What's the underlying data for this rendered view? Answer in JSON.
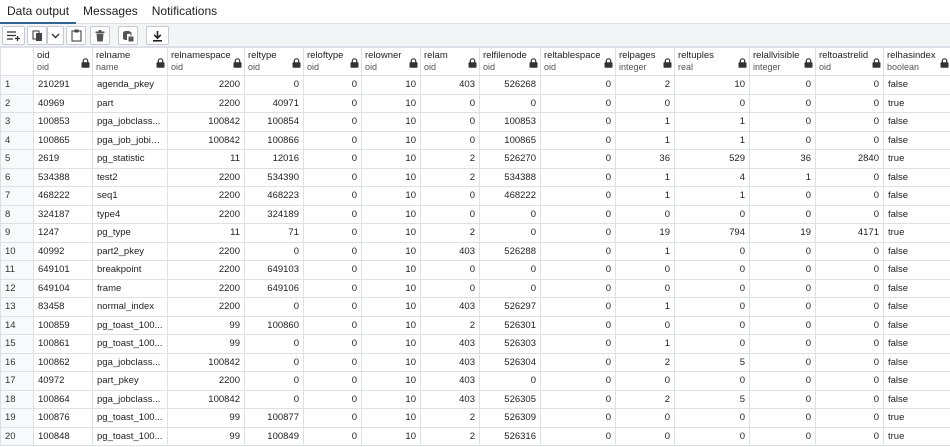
{
  "tabs": [
    {
      "label": "Data output",
      "active": true
    },
    {
      "label": "Messages",
      "active": false
    },
    {
      "label": "Notifications",
      "active": false
    }
  ],
  "toolbar": {
    "buttons": [
      {
        "icon": "add-row-icon"
      },
      {
        "icon": "copy-icon"
      },
      {
        "icon": "chevron-down-icon"
      },
      {
        "icon": "paste-icon"
      },
      {
        "icon": "delete-icon"
      },
      {
        "icon": "save-data-icon"
      },
      {
        "icon": "download-icon"
      }
    ]
  },
  "grid": {
    "columns": [
      {
        "name": "oid",
        "type": "oid",
        "locked": true,
        "align": "left"
      },
      {
        "name": "relname",
        "type": "name",
        "locked": true,
        "align": "left"
      },
      {
        "name": "relnamespace",
        "type": "oid",
        "locked": true,
        "align": "right"
      },
      {
        "name": "reltype",
        "type": "oid",
        "locked": true,
        "align": "right"
      },
      {
        "name": "reloftype",
        "type": "oid",
        "locked": true,
        "align": "right"
      },
      {
        "name": "relowner",
        "type": "oid",
        "locked": true,
        "align": "right"
      },
      {
        "name": "relam",
        "type": "oid",
        "locked": true,
        "align": "right"
      },
      {
        "name": "relfilenode",
        "type": "oid",
        "locked": true,
        "align": "right"
      },
      {
        "name": "reltablespace",
        "type": "oid",
        "locked": true,
        "align": "right"
      },
      {
        "name": "relpages",
        "type": "integer",
        "locked": true,
        "align": "right"
      },
      {
        "name": "reltuples",
        "type": "real",
        "locked": true,
        "align": "right"
      },
      {
        "name": "relallvisible",
        "type": "integer",
        "locked": true,
        "align": "right"
      },
      {
        "name": "reltoastrelid",
        "type": "oid",
        "locked": true,
        "align": "right"
      },
      {
        "name": "relhasindex",
        "type": "boolean",
        "locked": true,
        "align": "left"
      }
    ],
    "rows": [
      [
        "1",
        "210291",
        "agenda_pkey",
        "2200",
        "0",
        "0",
        "10",
        "403",
        "526268",
        "0",
        "2",
        "10",
        "0",
        "0",
        "false"
      ],
      [
        "2",
        "40969",
        "part",
        "2200",
        "40971",
        "0",
        "10",
        "0",
        "0",
        "0",
        "0",
        "0",
        "0",
        "0",
        "true"
      ],
      [
        "3",
        "100853",
        "pga_jobclass...",
        "100842",
        "100854",
        "0",
        "10",
        "0",
        "100853",
        "0",
        "1",
        "1",
        "0",
        "0",
        "false"
      ],
      [
        "4",
        "100865",
        "pga_job_jobid...",
        "100842",
        "100866",
        "0",
        "10",
        "0",
        "100865",
        "0",
        "1",
        "1",
        "0",
        "0",
        "false"
      ],
      [
        "5",
        "2619",
        "pg_statistic",
        "11",
        "12016",
        "0",
        "10",
        "2",
        "526270",
        "0",
        "36",
        "529",
        "36",
        "2840",
        "true"
      ],
      [
        "6",
        "534388",
        "test2",
        "2200",
        "534390",
        "0",
        "10",
        "2",
        "534388",
        "0",
        "1",
        "4",
        "1",
        "0",
        "false"
      ],
      [
        "7",
        "468222",
        "seq1",
        "2200",
        "468223",
        "0",
        "10",
        "0",
        "468222",
        "0",
        "1",
        "1",
        "0",
        "0",
        "false"
      ],
      [
        "8",
        "324187",
        "type4",
        "2200",
        "324189",
        "0",
        "10",
        "0",
        "0",
        "0",
        "0",
        "0",
        "0",
        "0",
        "false"
      ],
      [
        "9",
        "1247",
        "pg_type",
        "11",
        "71",
        "0",
        "10",
        "2",
        "0",
        "0",
        "19",
        "794",
        "19",
        "4171",
        "true"
      ],
      [
        "10",
        "40992",
        "part2_pkey",
        "2200",
        "0",
        "0",
        "10",
        "403",
        "526288",
        "0",
        "1",
        "0",
        "0",
        "0",
        "false"
      ],
      [
        "11",
        "649101",
        "breakpoint",
        "2200",
        "649103",
        "0",
        "10",
        "0",
        "0",
        "0",
        "0",
        "0",
        "0",
        "0",
        "false"
      ],
      [
        "12",
        "649104",
        "frame",
        "2200",
        "649106",
        "0",
        "10",
        "0",
        "0",
        "0",
        "0",
        "0",
        "0",
        "0",
        "false"
      ],
      [
        "13",
        "83458",
        "normal_index",
        "2200",
        "0",
        "0",
        "10",
        "403",
        "526297",
        "0",
        "1",
        "0",
        "0",
        "0",
        "false"
      ],
      [
        "14",
        "100859",
        "pg_toast_100...",
        "99",
        "100860",
        "0",
        "10",
        "2",
        "526301",
        "0",
        "0",
        "0",
        "0",
        "0",
        "false"
      ],
      [
        "15",
        "100861",
        "pg_toast_100...",
        "99",
        "0",
        "0",
        "10",
        "403",
        "526303",
        "0",
        "1",
        "0",
        "0",
        "0",
        "false"
      ],
      [
        "16",
        "100862",
        "pga_jobclass...",
        "100842",
        "0",
        "0",
        "10",
        "403",
        "526304",
        "0",
        "2",
        "5",
        "0",
        "0",
        "false"
      ],
      [
        "17",
        "40972",
        "part_pkey",
        "2200",
        "0",
        "0",
        "10",
        "403",
        "0",
        "0",
        "0",
        "0",
        "0",
        "0",
        "false"
      ],
      [
        "18",
        "100864",
        "pga_jobclass...",
        "100842",
        "0",
        "0",
        "10",
        "403",
        "526305",
        "0",
        "2",
        "5",
        "0",
        "0",
        "false"
      ],
      [
        "19",
        "100876",
        "pg_toast_100...",
        "99",
        "100877",
        "0",
        "10",
        "2",
        "526309",
        "0",
        "0",
        "0",
        "0",
        "0",
        "true"
      ],
      [
        "20",
        "100848",
        "pg_toast_100...",
        "99",
        "100849",
        "0",
        "10",
        "2",
        "526316",
        "0",
        "0",
        "0",
        "0",
        "0",
        "true"
      ]
    ]
  }
}
